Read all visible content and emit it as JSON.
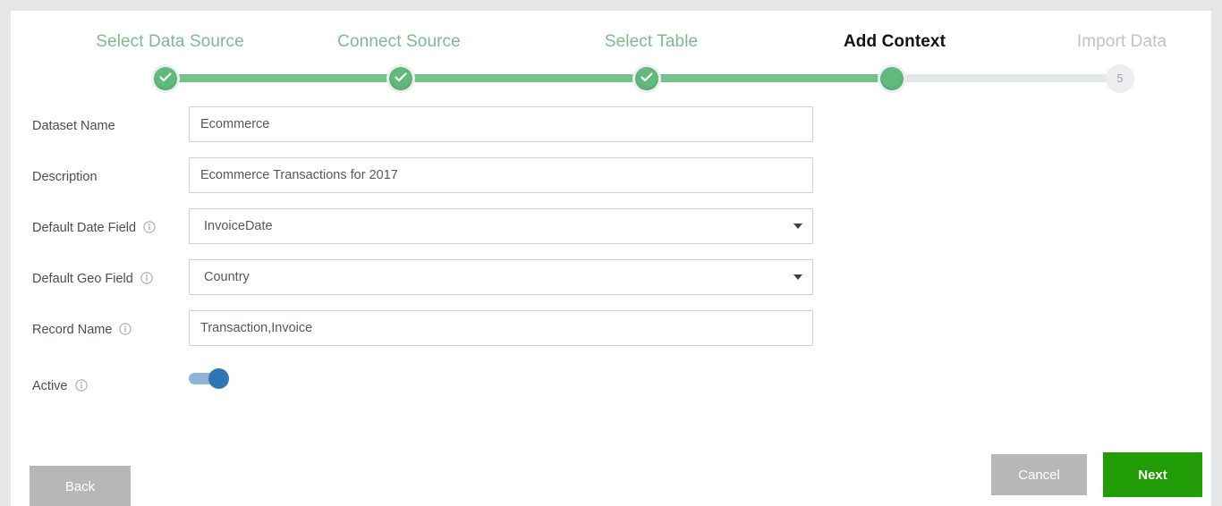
{
  "stepper": {
    "steps": [
      {
        "label": "Select Data Source",
        "state": "done",
        "marker": "check"
      },
      {
        "label": "Connect Source",
        "state": "done",
        "marker": "check"
      },
      {
        "label": "Select Table",
        "state": "done",
        "marker": "check"
      },
      {
        "label": "Add Context",
        "state": "active",
        "marker": ""
      },
      {
        "label": "Import Data",
        "state": "pending",
        "marker": "5"
      }
    ],
    "colors": {
      "done": "#62b97e",
      "track_done": "#78c18e",
      "track_todo": "#e3e7e8",
      "pending_text": "#bdc3c7",
      "active_text": "#111111"
    }
  },
  "form": {
    "fields": [
      {
        "label": "Dataset Name",
        "name": "dataset-name",
        "type": "text",
        "value": "Ecommerce",
        "placeholder": "Dataset Name",
        "info": false
      },
      {
        "label": "Description",
        "name": "description",
        "type": "text",
        "value": "Ecommerce Transactions for 2017",
        "placeholder": "Description",
        "info": false
      },
      {
        "label": "Default Date Field",
        "name": "default-date-field",
        "type": "select",
        "value": "InvoiceDate",
        "placeholder": "",
        "info": true
      },
      {
        "label": "Default Geo Field",
        "name": "default-geo-field",
        "type": "select",
        "value": "Country",
        "placeholder": "",
        "info": true
      },
      {
        "label": "Record Name",
        "name": "record-name",
        "type": "text",
        "value": "Transaction,Invoice",
        "placeholder": "Record Name",
        "info": true
      },
      {
        "label": "Active",
        "name": "active",
        "type": "toggle",
        "value": "on",
        "placeholder": "",
        "info": true
      }
    ]
  },
  "buttons": {
    "back": "Back",
    "cancel": "Cancel",
    "next": "Next",
    "colors": {
      "grey": "#b7b7b7",
      "green": "#219b06"
    }
  }
}
